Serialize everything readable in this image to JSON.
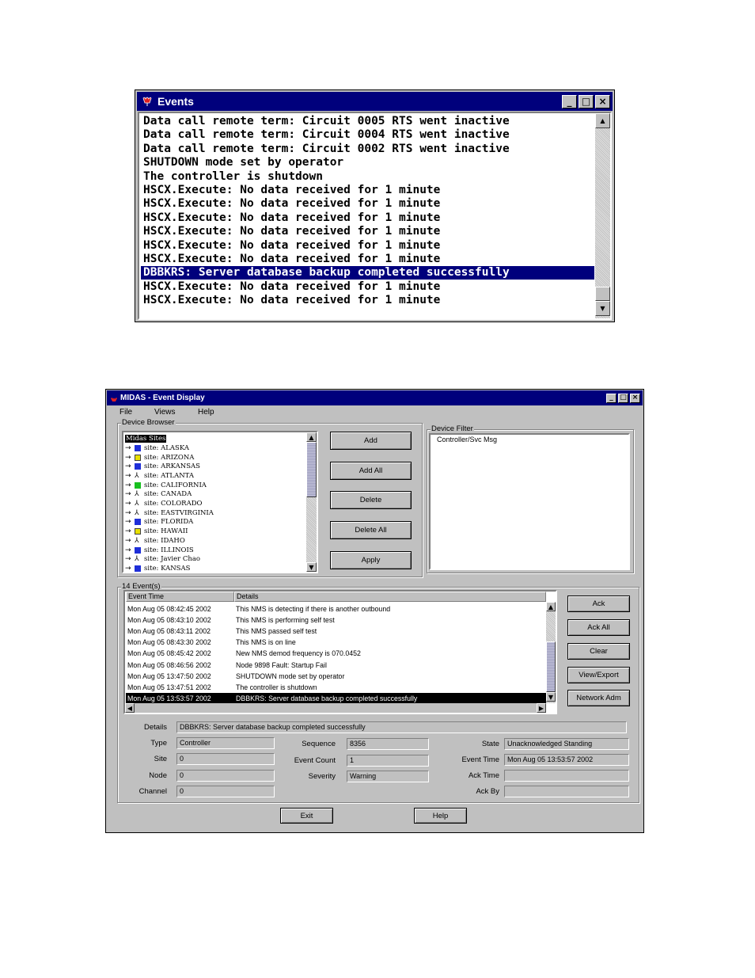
{
  "events_window": {
    "title": "Events",
    "icon": "tulip-app-icon",
    "lines": [
      "Data call remote term: Circuit 0005 RTS went inactive",
      "Data call remote term: Circuit 0004 RTS went inactive",
      "Data call remote term: Circuit 0002 RTS went inactive",
      "SHUTDOWN mode set by operator",
      "The controller is shutdown",
      "HSCX.Execute: No data received for 1 minute",
      "HSCX.Execute: No data received for 1 minute",
      "HSCX.Execute: No data received for 1 minute",
      "HSCX.Execute: No data received for 1 minute",
      "HSCX.Execute: No data received for 1 minute",
      "HSCX.Execute: No data received for 1 minute",
      "DBBKRS: Server database backup completed successfully",
      "HSCX.Execute: No data received for 1 minute",
      "HSCX.Execute: No data received for 1 minute"
    ],
    "selected_index": 11
  },
  "midas_window": {
    "title": "MIDAS - Event Display",
    "menu": [
      "File",
      "Views",
      "Help"
    ],
    "device_browser": {
      "label": "Device Browser",
      "root": "Midas Sites",
      "items": [
        {
          "label": "site: ALASKA",
          "icon": "blue"
        },
        {
          "label": "site: ARIZONA",
          "icon": "yellow-antenna"
        },
        {
          "label": "site: ARKANSAS",
          "icon": "blue"
        },
        {
          "label": "site: ATLANTA",
          "icon": "antenna"
        },
        {
          "label": "site: CALIFORNIA",
          "icon": "green"
        },
        {
          "label": "site: CANADA",
          "icon": "antenna"
        },
        {
          "label": "site: COLORADO",
          "icon": "antenna"
        },
        {
          "label": "site: EASTVIRGINIA",
          "icon": "antenna"
        },
        {
          "label": "site: FLORIDA",
          "icon": "blue"
        },
        {
          "label": "site: HAWAII",
          "icon": "yellow-antenna"
        },
        {
          "label": "site: IDAHO",
          "icon": "antenna"
        },
        {
          "label": "site: ILLINOIS",
          "icon": "blue"
        },
        {
          "label": "site: Javier Chao",
          "icon": "antenna"
        },
        {
          "label": "site: KANSAS",
          "icon": "blue"
        }
      ]
    },
    "buttons": {
      "add": "Add",
      "add_all": "Add All",
      "delete": "Delete",
      "delete_all": "Delete All",
      "apply": "Apply"
    },
    "device_filter": {
      "label": "Device Filter",
      "items": [
        "Controller/Svc Msg"
      ]
    },
    "events": {
      "label": "14 Event(s)",
      "columns": [
        "Event Time",
        "Details"
      ],
      "rows": [
        {
          "time": "Mon Aug 05 08:42:45 2002",
          "details": "This NMS is detecting if there is another outbound"
        },
        {
          "time": "Mon Aug 05 08:43:10 2002",
          "details": "This NMS is performing self test"
        },
        {
          "time": "Mon Aug 05 08:43:11 2002",
          "details": "This NMS passed self test"
        },
        {
          "time": "Mon Aug 05 08:43:30 2002",
          "details": "This NMS is on line"
        },
        {
          "time": "Mon Aug 05 08:45:42 2002",
          "details": "New NMS demod frequency is 070.0452"
        },
        {
          "time": "Mon Aug 05 08:46:56 2002",
          "details": "Node 9898 Fault: Startup Fail"
        },
        {
          "time": "Mon Aug 05 13:47:50 2002",
          "details": "SHUTDOWN mode set by operator"
        },
        {
          "time": "Mon Aug 05 13:47:51 2002",
          "details": "The controller is shutdown"
        },
        {
          "time": "Mon Aug 05 13:53:57 2002",
          "details": "DBBKRS: Server database backup completed successfully"
        }
      ],
      "selected_index": 8
    },
    "event_buttons": {
      "ack": "Ack",
      "ack_all": "Ack All",
      "clear": "Clear",
      "view_export": "View/Export",
      "network_adm": "Network Adm"
    },
    "detail": {
      "details_label": "Details",
      "details_value": "DBBKRS: Server database backup completed successfully",
      "type_label": "Type",
      "type_value": "Controller",
      "site_label": "Site",
      "site_value": "0",
      "node_label": "Node",
      "node_value": "0",
      "channel_label": "Channel",
      "channel_value": "0",
      "sequence_label": "Sequence",
      "sequence_value": "8356",
      "event_count_label": "Event Count",
      "event_count_value": "1",
      "severity_label": "Severity",
      "severity_value": "Warning",
      "state_label": "State",
      "state_value": "Unacknowledged Standing",
      "event_time_label": "Event Time",
      "event_time_value": "Mon Aug 05 13:53:57 2002",
      "ack_time_label": "Ack Time",
      "ack_time_value": "",
      "ack_by_label": "Ack By",
      "ack_by_value": ""
    },
    "footer": {
      "exit": "Exit",
      "help": "Help"
    }
  }
}
